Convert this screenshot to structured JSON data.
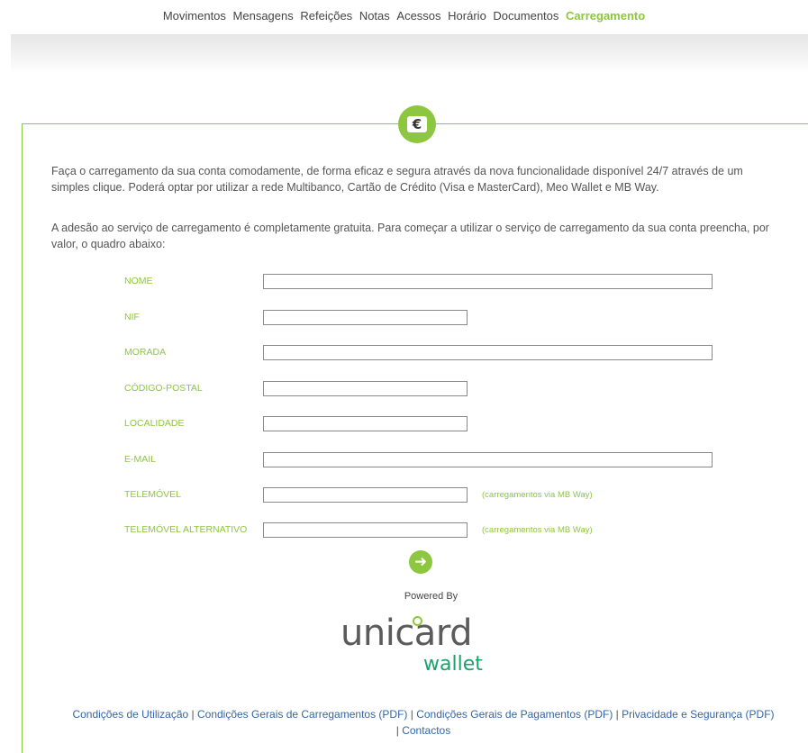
{
  "nav": {
    "items": [
      {
        "label": "Movimentos"
      },
      {
        "label": "Mensagens"
      },
      {
        "label": "Refeições"
      },
      {
        "label": "Notas"
      },
      {
        "label": "Acessos"
      },
      {
        "label": "Horário"
      },
      {
        "label": "Documentos"
      },
      {
        "label": "Carregamento",
        "active": true
      }
    ]
  },
  "badge": {
    "icon": "euro-icon",
    "glyph": "€"
  },
  "intro": {
    "p1": "Faça o carregamento da sua conta comodamente, de forma eficaz e segura através da nova funcionalidade disponível 24/7 através de um simples clique. Poderá optar por utilizar a rede Multibanco, Cartão de Crédito (Visa e MasterCard), Meo Wallet e MB Way.",
    "p2": "A adesão ao serviço de carregamento é completamente gratuita. Para começar a utilizar o serviço de carregamento da sua conta preencha, por valor, o quadro abaixo:"
  },
  "form": {
    "nome": {
      "label": "NOME",
      "value": ""
    },
    "nif": {
      "label": "NIF",
      "value": ""
    },
    "morada": {
      "label": "MORADA",
      "value": ""
    },
    "codigo_postal": {
      "label": "CÓDIGO-POSTAL",
      "value": ""
    },
    "localidade": {
      "label": "LOCALIDADE",
      "value": ""
    },
    "email": {
      "label": "E-MAIL",
      "value": ""
    },
    "telemovel": {
      "label": "TELEMÓVEL",
      "value": "",
      "hint": "(carregamentos via MB Way)"
    },
    "telemovel_alt": {
      "label": "TELEMÓVEL ALTERNATIVO",
      "value": "",
      "hint": "(carregamentos via MB Way)"
    },
    "submit_icon": "arrow-right-circle-icon",
    "submit_glyph": "➜"
  },
  "powered": {
    "label": "Powered By",
    "logo_text_main": "unicard",
    "logo_text_sub": "wallet"
  },
  "footer": {
    "links": [
      {
        "label": "Condições de Utilização"
      },
      {
        "label": "Condições Gerais de Carregamentos (PDF)"
      },
      {
        "label": "Condições Gerais de Pagamentos (PDF)"
      },
      {
        "label": "Privacidade e Segurança (PDF)"
      },
      {
        "label": "Contactos"
      }
    ],
    "separator": " | "
  },
  "colors": {
    "accent": "#8dc63f",
    "link": "#3366aa",
    "wallet_green": "#1aa36a"
  }
}
